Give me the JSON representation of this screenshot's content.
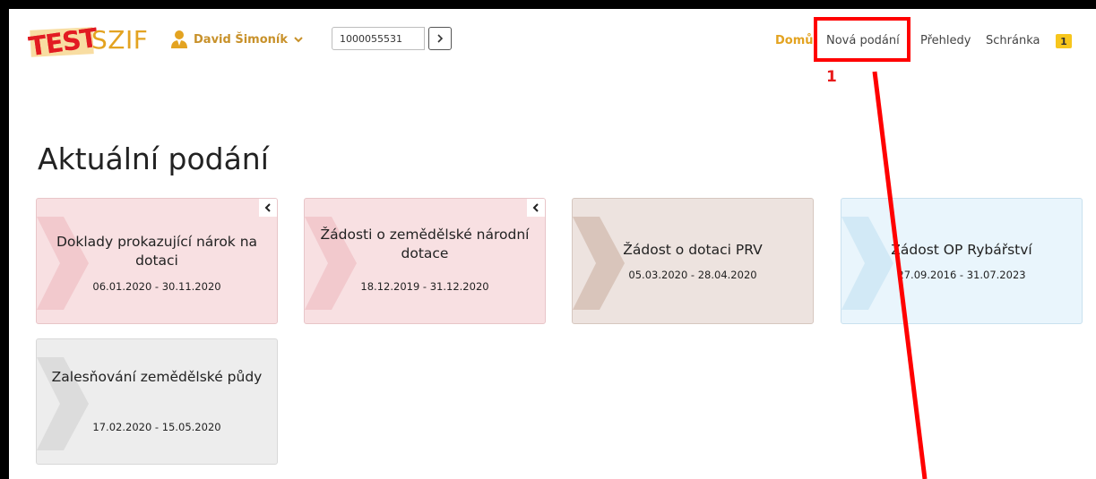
{
  "header": {
    "logo_test": "TEST",
    "logo_brand": "SZIF",
    "user_name": "David Šimoník",
    "subject_id": "1000055531",
    "nav": {
      "home": "Domů",
      "new_submission": "Nová podání",
      "overviews": "Přehledy",
      "inbox": "Schránka",
      "inbox_count": "1"
    }
  },
  "annotation": {
    "step_number": "1",
    "color": "#ff0000"
  },
  "main": {
    "title": "Aktuální podání",
    "cards": [
      {
        "title": "Doklady prokazující nárok na dotaci",
        "dates": "06.01.2020 - 30.11.2020",
        "color": "#f8e0e2",
        "collapsible": true
      },
      {
        "title": "Žádosti o zemědělské národní dotace",
        "dates": "18.12.2019 - 31.12.2020",
        "color": "#f8e0e2",
        "collapsible": true
      },
      {
        "title": "Žádost o dotaci PRV",
        "dates": "05.03.2020 - 28.04.2020",
        "color": "#ede3df",
        "collapsible": false
      },
      {
        "title": "Žádost OP Rybářství",
        "dates": "27.09.2016 - 31.07.2023",
        "color": "#e9f5fc",
        "collapsible": false
      },
      {
        "title": "Zalesňování zemědělské půdy",
        "dates": "17.02.2020 - 15.05.2020",
        "color": "#ededed",
        "collapsible": false
      }
    ]
  },
  "colors": {
    "accent": "#e3a321",
    "logo_red": "#e21b22",
    "badge": "#f7c61d"
  }
}
